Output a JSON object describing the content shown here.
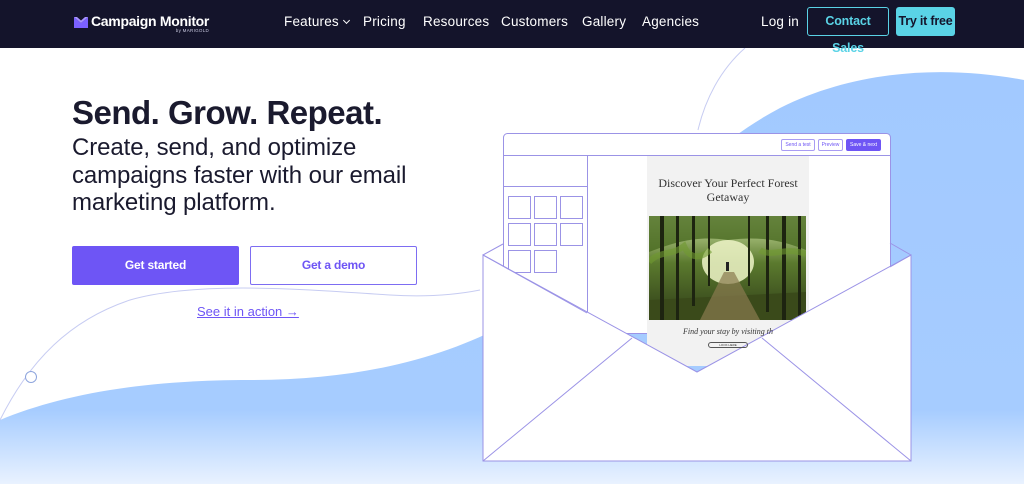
{
  "nav": {
    "brand": "Campaign Monitor",
    "brand_sub": "by MARIGOLD",
    "links": [
      "Features",
      "Pricing",
      "Resources",
      "Customers",
      "Gallery",
      "Agencies"
    ],
    "login": "Log in",
    "contact_sales": "Contact Sales",
    "try_free": "Try it free"
  },
  "hero": {
    "headline": "Send. Grow. Repeat.",
    "subheadline": "Create, send, and optimize campaigns faster with our email marketing platform.",
    "primary_cta": "Get started",
    "secondary_cta": "Get a demo",
    "action_link": "See it in action →"
  },
  "illustration": {
    "toolbar_buttons": [
      "Send a test",
      "Preview",
      "Save & next"
    ],
    "email_title": "Discover Your Perfect Forest Getaway",
    "email_footer": "Find your stay by visiting th",
    "email_button": "LOOK HERE"
  },
  "colors": {
    "nav_bg": "#14142b",
    "accent_purple": "#6e55f5",
    "accent_cyan": "#5ad3e6",
    "hero_blue": "#9fc8ff"
  }
}
